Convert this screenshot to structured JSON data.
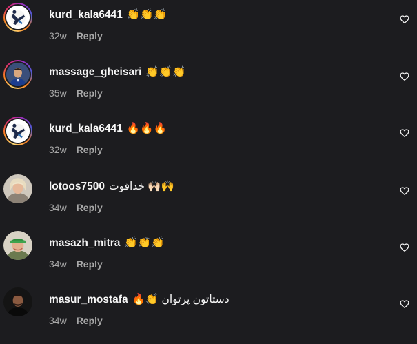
{
  "comments": [
    {
      "username": "kurd_kala6441",
      "text": "👏👏👏",
      "time": "32w",
      "reply": "Reply",
      "avatar_icon": "fighter-logo-icon",
      "like_icon": "heart-outline-icon"
    },
    {
      "username": "massage_gheisari",
      "text": "👏👏👏",
      "time": "35w",
      "reply": "Reply",
      "avatar_icon": "profile-photo-man-blue-shirt",
      "like_icon": "heart-outline-icon"
    },
    {
      "username": "kurd_kala6441",
      "text": "🔥🔥🔥",
      "time": "32w",
      "reply": "Reply",
      "avatar_icon": "fighter-logo-icon",
      "like_icon": "heart-outline-icon"
    },
    {
      "username": "lotoos7500",
      "text": "خداقوت 🙌🏻🙌",
      "time": "34w",
      "reply": "Reply",
      "avatar_icon": "profile-photo-woman-blonde",
      "like_icon": "heart-outline-icon"
    },
    {
      "username": "masazh_mitra",
      "text": "👏👏👏",
      "time": "34w",
      "reply": "Reply",
      "avatar_icon": "profile-photo-woman-green-scarf",
      "like_icon": "heart-outline-icon"
    },
    {
      "username": "masur_mostafa",
      "text": "🔥👏 دستاتون پرتوان",
      "time": "34w",
      "reply": "Reply",
      "avatar_icon": "profile-photo-man-dark",
      "like_icon": "heart-outline-icon"
    }
  ],
  "colors": {
    "background": "#1c1c1f",
    "text_primary": "#f5f5f5",
    "text_secondary": "#a8a8a8"
  }
}
